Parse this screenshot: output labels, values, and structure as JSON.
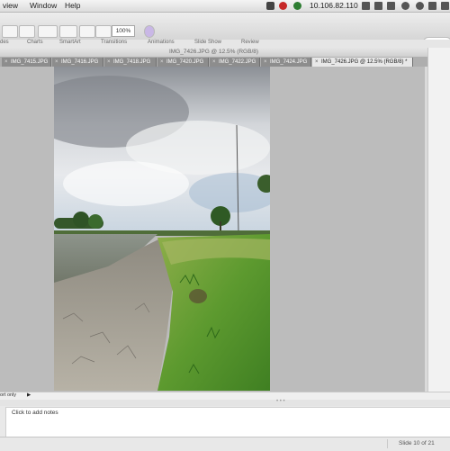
{
  "menubar": {
    "items": [
      "Window",
      "Help"
    ],
    "ip": "10.106.82.110"
  },
  "toolbar": {
    "zoom": "100%"
  },
  "ribbon": {
    "tabs": [
      "des",
      "Charts",
      "SmartArt",
      "Transitions",
      "Animations",
      "Slide Show",
      "Review"
    ]
  },
  "photoshop": {
    "document_title": "IMG_7426.JPG @ 12.5% (RGB/8)",
    "tabs": [
      {
        "label": "IMG_7415.JPG"
      },
      {
        "label": "IMG_7416.JPG"
      },
      {
        "label": "IMG_7418.JPG"
      },
      {
        "label": "IMG_7420.JPG"
      },
      {
        "label": "IMG_7422.JPG"
      },
      {
        "label": "IMG_7424.JPG"
      },
      {
        "label": "IMG_7426.JPG @ 12.5% (RGB/8) *"
      }
    ]
  },
  "status": {
    "left": "ort only",
    "arrow": "▶"
  },
  "notes": {
    "placeholder": "Click to add notes"
  },
  "statusbar": {
    "slide": "Slide 10 of 21"
  },
  "colors": {
    "accent": "#3b82f6",
    "canvas": "#bcbcbc",
    "tab_active": "#e8e8e8"
  }
}
